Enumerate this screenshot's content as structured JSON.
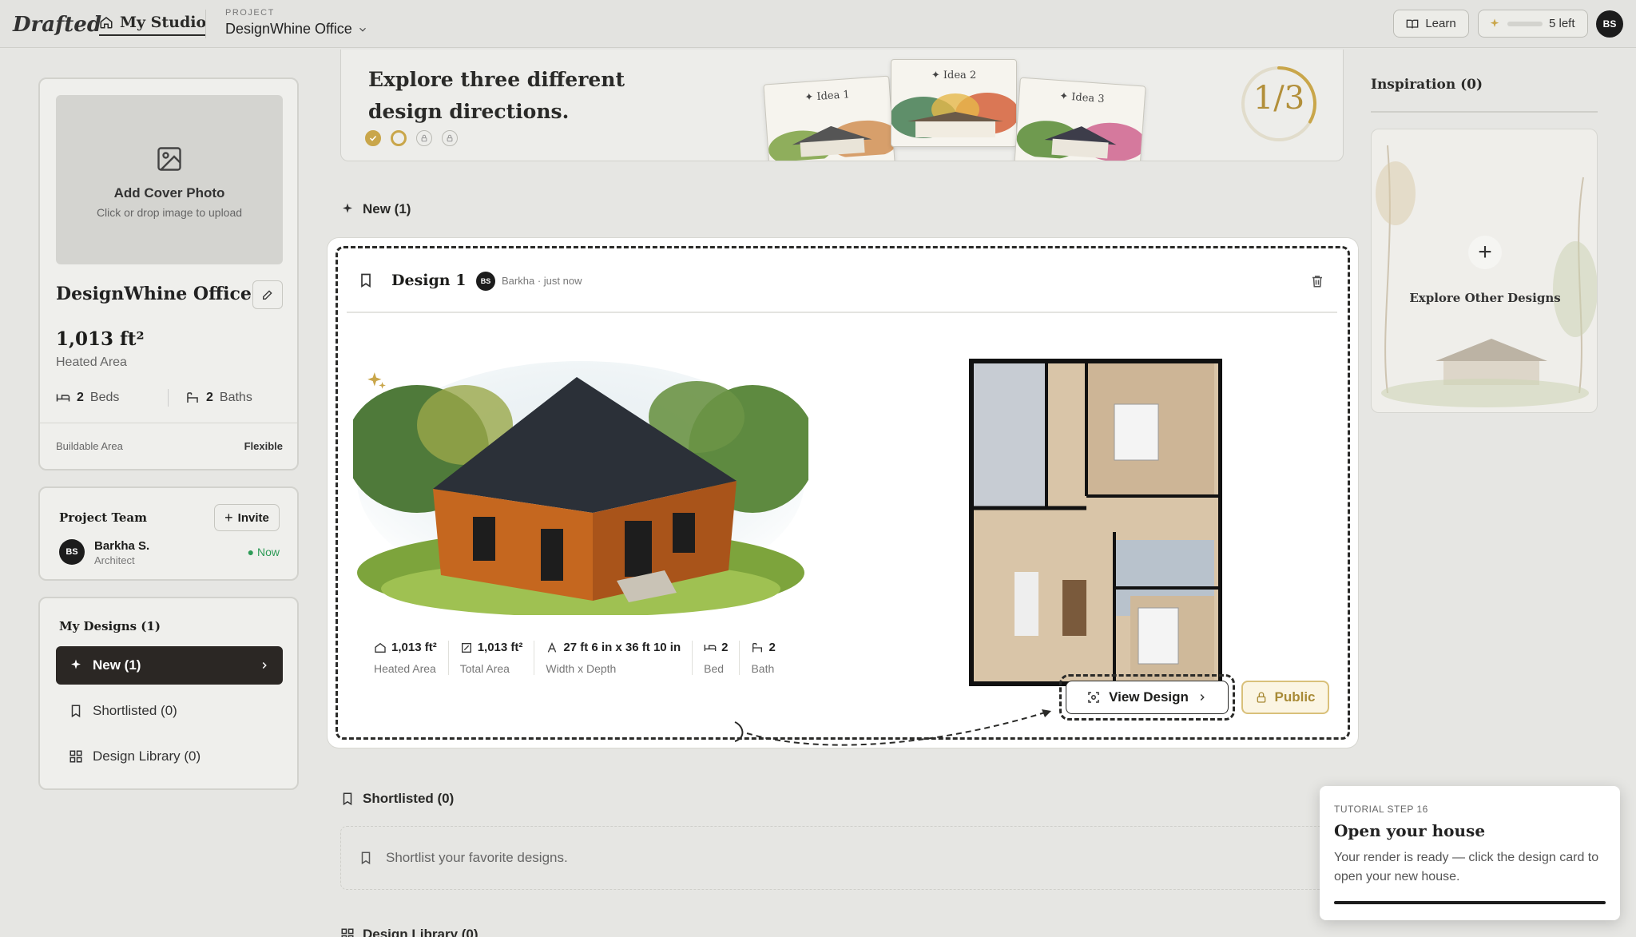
{
  "app": {
    "logo": "Drafted",
    "studio": "My Studio",
    "project_label": "PROJECT",
    "project_name": "DesignWhine Office"
  },
  "top": {
    "learn": "Learn",
    "credits": "5 left",
    "avatar": "BS"
  },
  "cover": {
    "title": "Add Cover Photo",
    "subtitle": "Click or drop image to upload"
  },
  "project": {
    "name": "DesignWhine Office",
    "area": "1,013 ft²",
    "area_label": "Heated Area",
    "beds": "2",
    "beds_label": "Beds",
    "baths": "2",
    "baths_label": "Baths",
    "buildable_label": "Buildable Area",
    "buildable_value": "Flexible"
  },
  "team": {
    "title": "Project Team",
    "invite": "Invite",
    "member": {
      "initials": "BS",
      "name": "Barkha S.",
      "role": "Architect",
      "status": "Now"
    }
  },
  "my_designs": {
    "title": "My Designs (1)",
    "items": [
      {
        "label": "New (1)"
      },
      {
        "label": "Shortlisted (0)"
      },
      {
        "label": "Design Library (0)"
      }
    ]
  },
  "banner": {
    "title_line1": "Explore three different",
    "title_line2": "design directions.",
    "ideas": [
      "Idea 1",
      "Idea 2",
      "Idea 3"
    ],
    "progress": "1/3",
    "progress_fraction": 0.333
  },
  "sections": {
    "new": "New (1)",
    "shortlisted": "Shortlisted (0)",
    "library": "Design Library (0)"
  },
  "design": {
    "title": "Design 1",
    "author_initials": "BS",
    "author": "Barkha",
    "time": "just now",
    "stats": [
      {
        "value": "1,013 ft²",
        "label": "Heated Area"
      },
      {
        "value": "1,013 ft²",
        "label": "Total Area"
      },
      {
        "value": "27 ft 6 in x 36 ft 10 in",
        "label": "Width x Depth"
      },
      {
        "value": "2",
        "label": "Bed"
      },
      {
        "value": "2",
        "label": "Bath"
      }
    ],
    "view_button": "View Design",
    "public_button": "Public"
  },
  "shortlist_empty": "Shortlist your favorite designs.",
  "inspiration": {
    "title": "Inspiration (0)",
    "explore": "Explore Other Designs"
  },
  "tutorial": {
    "step": "TUTORIAL STEP 16",
    "title": "Open your house",
    "body": "Your render is ready — click the design card to open your new house."
  },
  "colors": {
    "accent_gold": "#c9a64a",
    "dark": "#2b2724",
    "status_green": "#2e9b57"
  }
}
